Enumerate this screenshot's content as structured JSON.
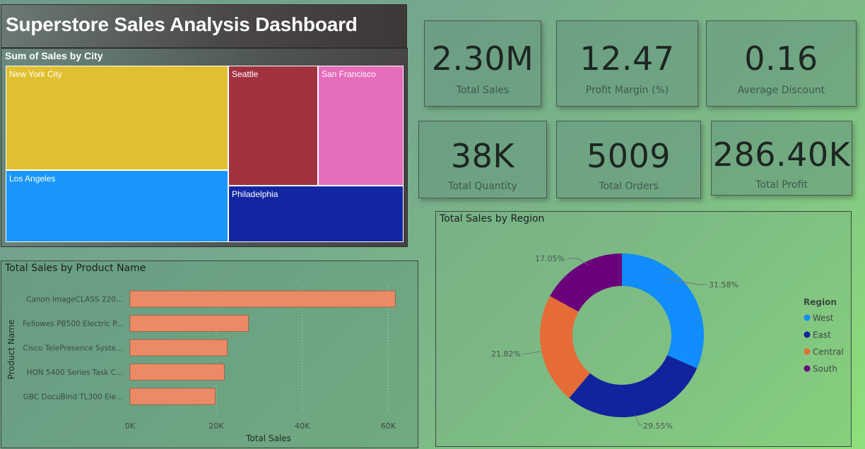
{
  "dashboard": {
    "title": "Superstore Sales Analysis Dashboard"
  },
  "treemap": {
    "title": "Sum of Sales by City",
    "cities": [
      {
        "name": "New York City",
        "color": "#e0c030"
      },
      {
        "name": "Los Angeles",
        "color": "#1a96ff"
      },
      {
        "name": "Seattle",
        "color": "#a33240"
      },
      {
        "name": "San Francisco",
        "color": "#e66cbc"
      },
      {
        "name": "Philadelphia",
        "color": "#1226a3"
      }
    ]
  },
  "kpis": {
    "total_sales": {
      "value": "2.30M",
      "label": "Total Sales"
    },
    "profit_margin": {
      "value": "12.47",
      "label": "Profit Margin (%)"
    },
    "avg_discount": {
      "value": "0.16",
      "label": "Average Discount"
    },
    "total_quantity": {
      "value": "38K",
      "label": "Total Quantity"
    },
    "total_orders": {
      "value": "5009",
      "label": "Total Orders"
    },
    "total_profit": {
      "value": "286.40K",
      "label": "Total Profit"
    }
  },
  "chart_data": [
    {
      "type": "bar",
      "orientation": "horizontal",
      "title": "Total Sales by Product Name",
      "xlabel": "Total Sales",
      "ylabel": "Product Name",
      "categories": [
        "Canon imageCLASS 220...",
        "Fellowes PB500 Electric P...",
        "Cisco TelePresence Syste...",
        "HON 5400 Series Task C...",
        "GBC DocuBind TL300 Ele..."
      ],
      "values": [
        61600,
        27500,
        22600,
        21900,
        19800
      ],
      "xlim": [
        0,
        65000
      ],
      "xticks": [
        0,
        20000,
        40000,
        60000
      ],
      "xtick_labels": [
        "0K",
        "20K",
        "40K",
        "60K"
      ],
      "bar_color": "#ec8a66",
      "grid": true
    },
    {
      "type": "pie",
      "style": "donut",
      "title": "Total Sales by Region",
      "legend_title": "Region",
      "legend_position": "right",
      "series": [
        {
          "name": "West",
          "value": 31.58,
          "label": "31.58%",
          "color": "#118dff"
        },
        {
          "name": "East",
          "value": 29.55,
          "label": "29.55%",
          "color": "#12239e"
        },
        {
          "name": "Central",
          "value": 21.82,
          "label": "21.82%",
          "color": "#e66c37"
        },
        {
          "name": "South",
          "value": 17.05,
          "label": "17.05%",
          "color": "#6b007b"
        }
      ]
    }
  ]
}
